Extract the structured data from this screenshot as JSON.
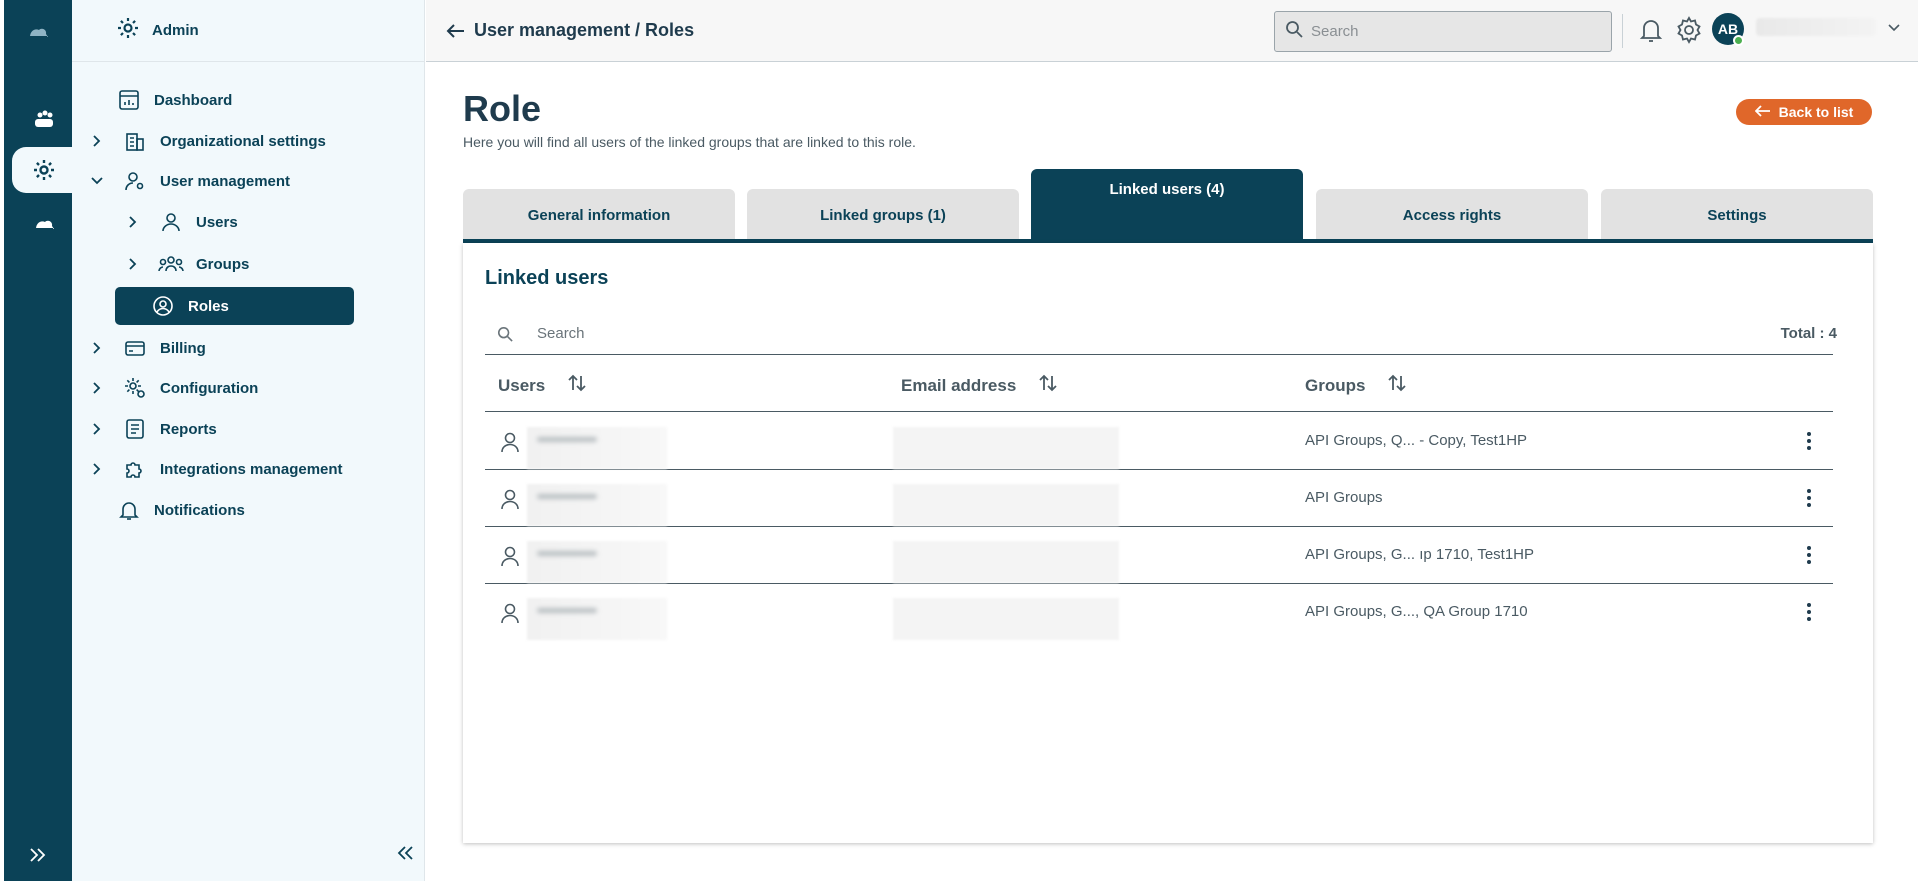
{
  "sidebar": {
    "header": "Admin",
    "items": [
      {
        "label": "Dashboard"
      },
      {
        "label": "Organizational settings"
      },
      {
        "label": "User management"
      },
      {
        "label": "Users"
      },
      {
        "label": "Groups"
      },
      {
        "label": "Roles"
      },
      {
        "label": "Billing"
      },
      {
        "label": "Configuration"
      },
      {
        "label": "Reports"
      },
      {
        "label": "Integrations management"
      },
      {
        "label": "Notifications"
      }
    ]
  },
  "topbar": {
    "breadcrumb": "User management / Roles",
    "search_placeholder": "Search",
    "avatar_initials": "AB"
  },
  "page": {
    "title": "Role",
    "subtitle": "Here you will find all users of the linked groups that are linked to this role.",
    "back_button": "Back to list"
  },
  "tabs": [
    {
      "label": "General information",
      "active": false
    },
    {
      "label": "Linked groups (1)",
      "active": false
    },
    {
      "label": "Linked users (4)",
      "active": true
    },
    {
      "label": "Access rights",
      "active": false
    },
    {
      "label": "Settings",
      "active": false
    }
  ],
  "panel": {
    "title": "Linked users",
    "search_placeholder": "Search",
    "total": "Total : 4",
    "columns": [
      "Users",
      "Email address",
      "Groups"
    ],
    "rows": [
      {
        "groups": "API Groups, Q... - Copy, Test1HP"
      },
      {
        "groups": "API Groups"
      },
      {
        "groups": "API Groups, G... ıp 1710, Test1HP"
      },
      {
        "groups": "API Groups, G..., QA Group 1710"
      }
    ]
  },
  "colors": {
    "primary": "#0b4257",
    "accent": "#e0672a",
    "sidebar_bg": "#f2f9fc"
  }
}
